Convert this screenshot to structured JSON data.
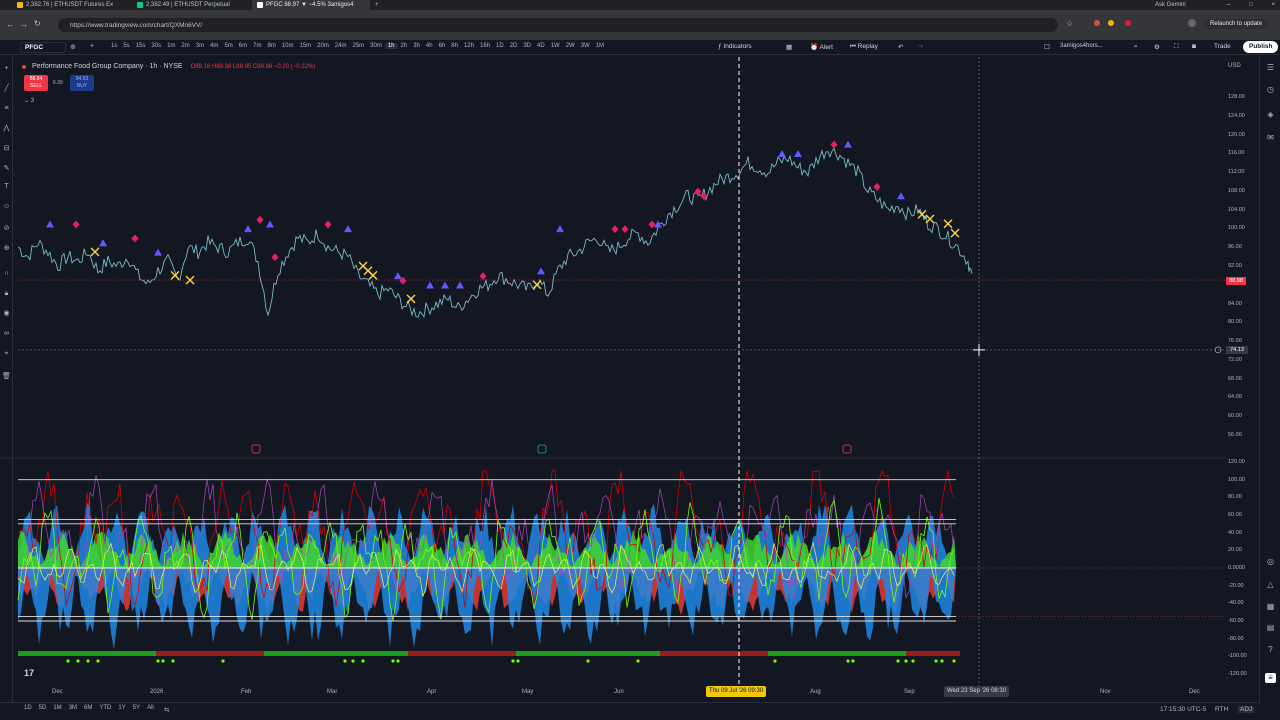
{
  "browser": {
    "tabs": [
      {
        "title": "2,382.76 | ETHUSDT Futures Ex",
        "active": false
      },
      {
        "title": "2,382.49 | ETHUSDT Perpetual",
        "active": false
      },
      {
        "title": "PFGC 88.97 ▼ −4.5% 3amigos4",
        "active": true
      }
    ],
    "url": "https://www.tradingview.com/chart/QXMn6VV/",
    "relaunch_label": "Relaunch to update",
    "gemini_label": "Ask Gemini"
  },
  "toolbar": {
    "symbol": "PFGC",
    "timeframes": [
      "1s",
      "5s",
      "15s",
      "30s",
      "1m",
      "2m",
      "3m",
      "4m",
      "5m",
      "6m",
      "7m",
      "8m",
      "10m",
      "15m",
      "20m",
      "24m",
      "25m",
      "30m",
      "1h",
      "2h",
      "3h",
      "4h",
      "6h",
      "8h",
      "12h",
      "16h",
      "1D",
      "2D",
      "3D",
      "4D",
      "1W",
      "2W",
      "3W",
      "1M"
    ],
    "selected_timeframe": "1h",
    "indicators_label": "Indicators",
    "alert_label": "Alert",
    "replay_label": "Replay",
    "layout_name": "3amigos4hors...",
    "trade_label": "Trade",
    "publish_label": "Publish"
  },
  "legend": {
    "title": "Performance Food Group Company · 1h · NYSE",
    "ohlc": "O89.16 H89.38 L88.95 C88.98 −0.20 (−0.22%)",
    "sell_price": "88.94",
    "sell_label": "SELL",
    "spread": "6.39",
    "buy_price": "94.93",
    "buy_label": "BUY",
    "indicator_count": "3",
    "currency": "USD"
  },
  "price_axis": {
    "labels": [
      "128.00",
      "124.00",
      "120.00",
      "116.00",
      "112.00",
      "108.00",
      "104.00",
      "100.00",
      "96.00",
      "92.00",
      "84.00",
      "80.00",
      "76.00",
      "72.00",
      "68.00",
      "64.00",
      "60.00",
      "56.00"
    ],
    "last_price": "88.98",
    "crosshair_price": "74.13"
  },
  "osc_axis": {
    "labels": [
      "120.00",
      "100.00",
      "80.00",
      "60.00",
      "40.00",
      "20.00",
      "0.0000",
      "-20.00",
      "-40.00",
      "-60.00",
      "-80.00",
      "-100.00",
      "-120.00"
    ]
  },
  "time_axis": {
    "labels": [
      "Dec",
      "2026",
      "Feb",
      "Mar",
      "Apr",
      "May",
      "Jun",
      "Aug",
      "Sep",
      "Nov",
      "Dec"
    ],
    "vline_date": "Thu 09 Jul '26  09:30",
    "cross_date": "Wed 23 Sep '26  08:30"
  },
  "bottom": {
    "ranges": [
      "1D",
      "5D",
      "1M",
      "3M",
      "6M",
      "YTD",
      "1Y",
      "5Y",
      "All"
    ],
    "clock": "17:15:30 UTC-5",
    "session": "RTH",
    "adj": "ADJ"
  },
  "chart_data": {
    "type": "line",
    "title": "",
    "ylim": [
      52,
      130
    ],
    "price_series": {
      "name": "PFGC 1h",
      "x": [
        "Dec",
        "2026",
        "Feb",
        "Mar",
        "Apr",
        "May",
        "Jun",
        "Jul",
        "Aug",
        "Sep"
      ],
      "points": [
        [
          0,
          96
        ],
        [
          10,
          94
        ],
        [
          20,
          97
        ],
        [
          30,
          95
        ],
        [
          40,
          92
        ],
        [
          50,
          94
        ],
        [
          60,
          93
        ],
        [
          70,
          95
        ],
        [
          80,
          91
        ],
        [
          90,
          93
        ],
        [
          100,
          92
        ],
        [
          110,
          94
        ],
        [
          120,
          90
        ],
        [
          130,
          88
        ],
        [
          140,
          91
        ],
        [
          150,
          93
        ],
        [
          160,
          89
        ],
        [
          170,
          96
        ],
        [
          180,
          95
        ],
        [
          190,
          97
        ],
        [
          200,
          96
        ],
        [
          210,
          95
        ],
        [
          220,
          97
        ],
        [
          230,
          98
        ],
        [
          240,
          93
        ],
        [
          250,
          82
        ],
        [
          260,
          91
        ],
        [
          270,
          95
        ],
        [
          280,
          98
        ],
        [
          290,
          97
        ],
        [
          300,
          99
        ],
        [
          310,
          96
        ],
        [
          320,
          95
        ],
        [
          330,
          94
        ],
        [
          340,
          90
        ],
        [
          350,
          88
        ],
        [
          360,
          86
        ],
        [
          370,
          87
        ],
        [
          380,
          85
        ],
        [
          390,
          83
        ],
        [
          400,
          82
        ],
        [
          410,
          83
        ],
        [
          420,
          84
        ],
        [
          430,
          85
        ],
        [
          440,
          83
        ],
        [
          450,
          85
        ],
        [
          460,
          87
        ],
        [
          470,
          88
        ],
        [
          480,
          90
        ],
        [
          490,
          89
        ],
        [
          500,
          88
        ],
        [
          510,
          87
        ],
        [
          520,
          89
        ],
        [
          530,
          86
        ],
        [
          540,
          91
        ],
        [
          550,
          94
        ],
        [
          560,
          95
        ],
        [
          570,
          97
        ],
        [
          580,
          98
        ],
        [
          590,
          95
        ],
        [
          600,
          96
        ],
        [
          610,
          98
        ],
        [
          620,
          99
        ],
        [
          630,
          97
        ],
        [
          640,
          100
        ],
        [
          650,
          103
        ],
        [
          660,
          105
        ],
        [
          670,
          107
        ],
        [
          680,
          106
        ],
        [
          690,
          108
        ],
        [
          700,
          110
        ],
        [
          710,
          111
        ],
        [
          720,
          112
        ],
        [
          730,
          114
        ],
        [
          740,
          113
        ],
        [
          750,
          112
        ],
        [
          760,
          114
        ],
        [
          770,
          115
        ],
        [
          780,
          113
        ],
        [
          790,
          112
        ],
        [
          800,
          115
        ],
        [
          810,
          117
        ],
        [
          820,
          116
        ],
        [
          830,
          114
        ],
        [
          840,
          112
        ],
        [
          850,
          108
        ],
        [
          860,
          106
        ],
        [
          870,
          104
        ],
        [
          880,
          105
        ],
        [
          890,
          103
        ],
        [
          900,
          104
        ],
        [
          910,
          101
        ],
        [
          920,
          100
        ],
        [
          930,
          98
        ],
        [
          940,
          96
        ],
        [
          950,
          93
        ],
        [
          955,
          89
        ]
      ]
    },
    "oscillator_levels": [
      100,
      55,
      50,
      0,
      -55,
      -60
    ],
    "markers": {
      "blue_triangles": [
        [
          32,
          100
        ],
        [
          85,
          96
        ],
        [
          140,
          94
        ],
        [
          230,
          99
        ],
        [
          252,
          100
        ],
        [
          330,
          99
        ],
        [
          380,
          89
        ],
        [
          412,
          87
        ],
        [
          427,
          87
        ],
        [
          442,
          87
        ],
        [
          523,
          90
        ],
        [
          542,
          99
        ],
        [
          640,
          100
        ],
        [
          764,
          115
        ],
        [
          780,
          115
        ],
        [
          830,
          117
        ],
        [
          883,
          106
        ]
      ],
      "pink_diamonds": [
        [
          58,
          100
        ],
        [
          117,
          97
        ],
        [
          242,
          101
        ],
        [
          257,
          93
        ],
        [
          310,
          100
        ],
        [
          385,
          88
        ],
        [
          465,
          89
        ],
        [
          597,
          99
        ],
        [
          607,
          99
        ],
        [
          634,
          100
        ],
        [
          680,
          107
        ],
        [
          686,
          106
        ],
        [
          816,
          117
        ],
        [
          859,
          108
        ]
      ],
      "yellow_crosses": [
        [
          77,
          95
        ],
        [
          157,
          90
        ],
        [
          172,
          89
        ],
        [
          345,
          92
        ],
        [
          350,
          91
        ],
        [
          355,
          90
        ],
        [
          393,
          85
        ],
        [
          519,
          88
        ],
        [
          904,
          103
        ],
        [
          912,
          102
        ],
        [
          930,
          101
        ],
        [
          937,
          99
        ]
      ]
    }
  }
}
